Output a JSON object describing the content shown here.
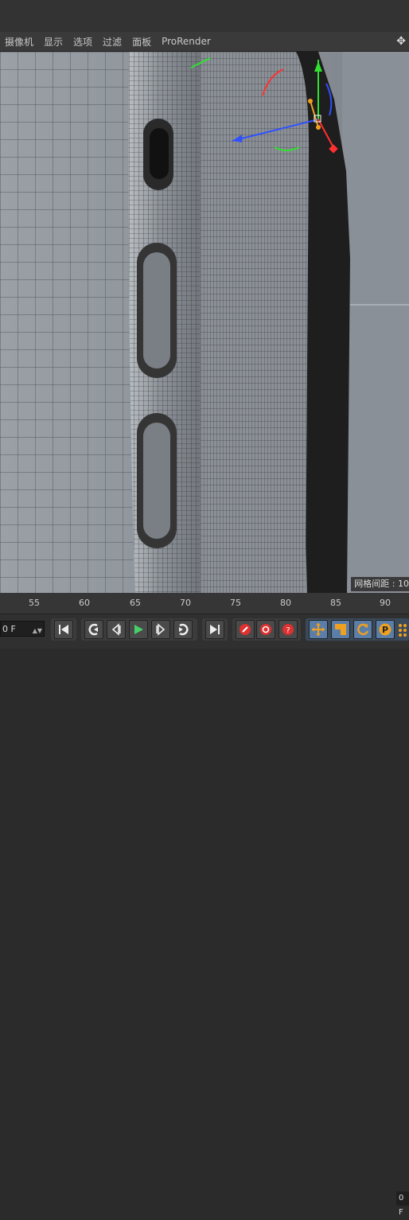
{
  "menu": {
    "items": [
      "摄像机",
      "显示",
      "选项",
      "过滤",
      "面板",
      "ProRender"
    ]
  },
  "viewport": {
    "grid_spacing_label": "网格间距 : 10"
  },
  "timeline": {
    "ticks": [
      "55",
      "60",
      "65",
      "70",
      "75",
      "80",
      "85",
      "90"
    ],
    "current_frame_right": "0 F"
  },
  "controls": {
    "frame_field": "0 F",
    "buttons": [
      {
        "name": "goto-start-button",
        "icon": "goto-start-icon"
      },
      {
        "name": "prev-key-button",
        "icon": "prev-key-icon"
      },
      {
        "name": "prev-frame-button",
        "icon": "prev-frame-icon"
      },
      {
        "name": "play-button",
        "icon": "play-icon"
      },
      {
        "name": "next-frame-button",
        "icon": "next-frame-icon"
      },
      {
        "name": "next-key-button",
        "icon": "next-key-icon"
      },
      {
        "name": "goto-end-button",
        "icon": "goto-end-icon"
      },
      {
        "name": "record-button",
        "icon": "record-key-icon"
      },
      {
        "name": "autokey-button",
        "icon": "autokey-icon"
      },
      {
        "name": "keyframe-selection-button",
        "icon": "help-icon"
      },
      {
        "name": "position-key-button",
        "icon": "move-icon"
      },
      {
        "name": "scale-key-button",
        "icon": "scale-icon"
      },
      {
        "name": "rotation-key-button",
        "icon": "rotate-icon"
      },
      {
        "name": "parameter-key-button",
        "icon": "parameter-icon"
      }
    ]
  },
  "colors": {
    "accent_orange": "#f0a020",
    "record_red": "#e03030",
    "play_green": "#46d06a",
    "axis_x": "#ff3030",
    "axis_y": "#30e030",
    "axis_z": "#3050ff"
  }
}
